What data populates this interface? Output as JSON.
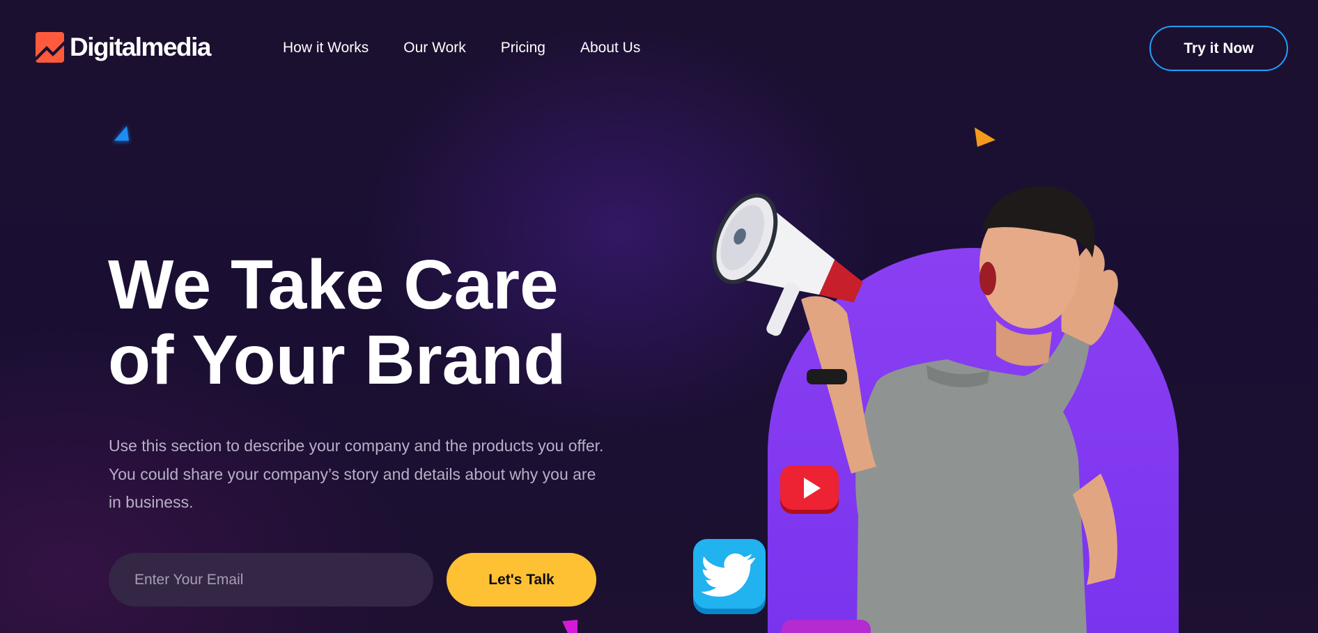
{
  "brand": {
    "name": "Digitalmedia",
    "logo_color": "#ff5a3c"
  },
  "nav": {
    "items": [
      {
        "label": "How it Works"
      },
      {
        "label": "Our Work"
      },
      {
        "label": "Pricing"
      },
      {
        "label": "About Us"
      }
    ],
    "cta_label": "Try it Now",
    "cta_border_color": "#1ea0ff"
  },
  "hero": {
    "title_line1": "We Take Care",
    "title_line2": "of Your Brand",
    "description": "Use this section to describe your company and the products you offer. You could share your company’s story and details about why you are in business.",
    "email_placeholder": "Enter Your Email",
    "submit_label": "Let's Talk",
    "submit_color": "#fdc133",
    "arch_color": "#8b3ff2"
  },
  "social_icons": [
    {
      "name": "youtube-icon",
      "color": "#e8132a"
    },
    {
      "name": "twitter-icon",
      "color": "#1da1f2"
    }
  ]
}
